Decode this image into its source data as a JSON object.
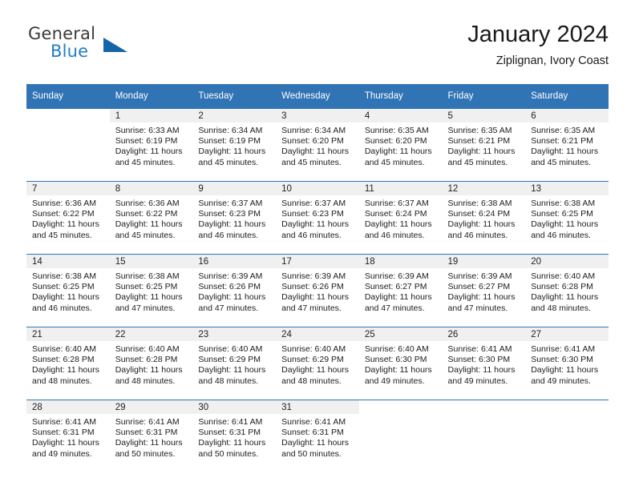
{
  "brand": {
    "name_top": "General",
    "name_bottom": "Blue",
    "accent_color": "#1565a8",
    "text_color": "#3a3a3a",
    "triangle_icon": "triangle-icon"
  },
  "header": {
    "title": "January 2024",
    "subtitle": "Ziplignan, Ivory Coast"
  },
  "theme": {
    "header_bg": "#3174b5",
    "header_text": "#ffffff",
    "daynum_band_bg": "#f0f0f0",
    "cell_bg": "#ffffff"
  },
  "weekday_headers": [
    "Sunday",
    "Monday",
    "Tuesday",
    "Wednesday",
    "Thursday",
    "Friday",
    "Saturday"
  ],
  "weeks": [
    [
      {
        "day": "",
        "sunrise": "",
        "sunset": "",
        "daylight_line1": "",
        "daylight_line2": ""
      },
      {
        "day": "1",
        "sunrise": "Sunrise: 6:33 AM",
        "sunset": "Sunset: 6:19 PM",
        "daylight_line1": "Daylight: 11 hours",
        "daylight_line2": "and 45 minutes."
      },
      {
        "day": "2",
        "sunrise": "Sunrise: 6:34 AM",
        "sunset": "Sunset: 6:19 PM",
        "daylight_line1": "Daylight: 11 hours",
        "daylight_line2": "and 45 minutes."
      },
      {
        "day": "3",
        "sunrise": "Sunrise: 6:34 AM",
        "sunset": "Sunset: 6:20 PM",
        "daylight_line1": "Daylight: 11 hours",
        "daylight_line2": "and 45 minutes."
      },
      {
        "day": "4",
        "sunrise": "Sunrise: 6:35 AM",
        "sunset": "Sunset: 6:20 PM",
        "daylight_line1": "Daylight: 11 hours",
        "daylight_line2": "and 45 minutes."
      },
      {
        "day": "5",
        "sunrise": "Sunrise: 6:35 AM",
        "sunset": "Sunset: 6:21 PM",
        "daylight_line1": "Daylight: 11 hours",
        "daylight_line2": "and 45 minutes."
      },
      {
        "day": "6",
        "sunrise": "Sunrise: 6:35 AM",
        "sunset": "Sunset: 6:21 PM",
        "daylight_line1": "Daylight: 11 hours",
        "daylight_line2": "and 45 minutes."
      }
    ],
    [
      {
        "day": "7",
        "sunrise": "Sunrise: 6:36 AM",
        "sunset": "Sunset: 6:22 PM",
        "daylight_line1": "Daylight: 11 hours",
        "daylight_line2": "and 45 minutes."
      },
      {
        "day": "8",
        "sunrise": "Sunrise: 6:36 AM",
        "sunset": "Sunset: 6:22 PM",
        "daylight_line1": "Daylight: 11 hours",
        "daylight_line2": "and 45 minutes."
      },
      {
        "day": "9",
        "sunrise": "Sunrise: 6:37 AM",
        "sunset": "Sunset: 6:23 PM",
        "daylight_line1": "Daylight: 11 hours",
        "daylight_line2": "and 46 minutes."
      },
      {
        "day": "10",
        "sunrise": "Sunrise: 6:37 AM",
        "sunset": "Sunset: 6:23 PM",
        "daylight_line1": "Daylight: 11 hours",
        "daylight_line2": "and 46 minutes."
      },
      {
        "day": "11",
        "sunrise": "Sunrise: 6:37 AM",
        "sunset": "Sunset: 6:24 PM",
        "daylight_line1": "Daylight: 11 hours",
        "daylight_line2": "and 46 minutes."
      },
      {
        "day": "12",
        "sunrise": "Sunrise: 6:38 AM",
        "sunset": "Sunset: 6:24 PM",
        "daylight_line1": "Daylight: 11 hours",
        "daylight_line2": "and 46 minutes."
      },
      {
        "day": "13",
        "sunrise": "Sunrise: 6:38 AM",
        "sunset": "Sunset: 6:25 PM",
        "daylight_line1": "Daylight: 11 hours",
        "daylight_line2": "and 46 minutes."
      }
    ],
    [
      {
        "day": "14",
        "sunrise": "Sunrise: 6:38 AM",
        "sunset": "Sunset: 6:25 PM",
        "daylight_line1": "Daylight: 11 hours",
        "daylight_line2": "and 46 minutes."
      },
      {
        "day": "15",
        "sunrise": "Sunrise: 6:38 AM",
        "sunset": "Sunset: 6:25 PM",
        "daylight_line1": "Daylight: 11 hours",
        "daylight_line2": "and 47 minutes."
      },
      {
        "day": "16",
        "sunrise": "Sunrise: 6:39 AM",
        "sunset": "Sunset: 6:26 PM",
        "daylight_line1": "Daylight: 11 hours",
        "daylight_line2": "and 47 minutes."
      },
      {
        "day": "17",
        "sunrise": "Sunrise: 6:39 AM",
        "sunset": "Sunset: 6:26 PM",
        "daylight_line1": "Daylight: 11 hours",
        "daylight_line2": "and 47 minutes."
      },
      {
        "day": "18",
        "sunrise": "Sunrise: 6:39 AM",
        "sunset": "Sunset: 6:27 PM",
        "daylight_line1": "Daylight: 11 hours",
        "daylight_line2": "and 47 minutes."
      },
      {
        "day": "19",
        "sunrise": "Sunrise: 6:39 AM",
        "sunset": "Sunset: 6:27 PM",
        "daylight_line1": "Daylight: 11 hours",
        "daylight_line2": "and 47 minutes."
      },
      {
        "day": "20",
        "sunrise": "Sunrise: 6:40 AM",
        "sunset": "Sunset: 6:28 PM",
        "daylight_line1": "Daylight: 11 hours",
        "daylight_line2": "and 48 minutes."
      }
    ],
    [
      {
        "day": "21",
        "sunrise": "Sunrise: 6:40 AM",
        "sunset": "Sunset: 6:28 PM",
        "daylight_line1": "Daylight: 11 hours",
        "daylight_line2": "and 48 minutes."
      },
      {
        "day": "22",
        "sunrise": "Sunrise: 6:40 AM",
        "sunset": "Sunset: 6:28 PM",
        "daylight_line1": "Daylight: 11 hours",
        "daylight_line2": "and 48 minutes."
      },
      {
        "day": "23",
        "sunrise": "Sunrise: 6:40 AM",
        "sunset": "Sunset: 6:29 PM",
        "daylight_line1": "Daylight: 11 hours",
        "daylight_line2": "and 48 minutes."
      },
      {
        "day": "24",
        "sunrise": "Sunrise: 6:40 AM",
        "sunset": "Sunset: 6:29 PM",
        "daylight_line1": "Daylight: 11 hours",
        "daylight_line2": "and 48 minutes."
      },
      {
        "day": "25",
        "sunrise": "Sunrise: 6:40 AM",
        "sunset": "Sunset: 6:30 PM",
        "daylight_line1": "Daylight: 11 hours",
        "daylight_line2": "and 49 minutes."
      },
      {
        "day": "26",
        "sunrise": "Sunrise: 6:41 AM",
        "sunset": "Sunset: 6:30 PM",
        "daylight_line1": "Daylight: 11 hours",
        "daylight_line2": "and 49 minutes."
      },
      {
        "day": "27",
        "sunrise": "Sunrise: 6:41 AM",
        "sunset": "Sunset: 6:30 PM",
        "daylight_line1": "Daylight: 11 hours",
        "daylight_line2": "and 49 minutes."
      }
    ],
    [
      {
        "day": "28",
        "sunrise": "Sunrise: 6:41 AM",
        "sunset": "Sunset: 6:31 PM",
        "daylight_line1": "Daylight: 11 hours",
        "daylight_line2": "and 49 minutes."
      },
      {
        "day": "29",
        "sunrise": "Sunrise: 6:41 AM",
        "sunset": "Sunset: 6:31 PM",
        "daylight_line1": "Daylight: 11 hours",
        "daylight_line2": "and 50 minutes."
      },
      {
        "day": "30",
        "sunrise": "Sunrise: 6:41 AM",
        "sunset": "Sunset: 6:31 PM",
        "daylight_line1": "Daylight: 11 hours",
        "daylight_line2": "and 50 minutes."
      },
      {
        "day": "31",
        "sunrise": "Sunrise: 6:41 AM",
        "sunset": "Sunset: 6:31 PM",
        "daylight_line1": "Daylight: 11 hours",
        "daylight_line2": "and 50 minutes."
      },
      {
        "day": "",
        "sunrise": "",
        "sunset": "",
        "daylight_line1": "",
        "daylight_line2": ""
      },
      {
        "day": "",
        "sunrise": "",
        "sunset": "",
        "daylight_line1": "",
        "daylight_line2": ""
      },
      {
        "day": "",
        "sunrise": "",
        "sunset": "",
        "daylight_line1": "",
        "daylight_line2": ""
      }
    ]
  ]
}
